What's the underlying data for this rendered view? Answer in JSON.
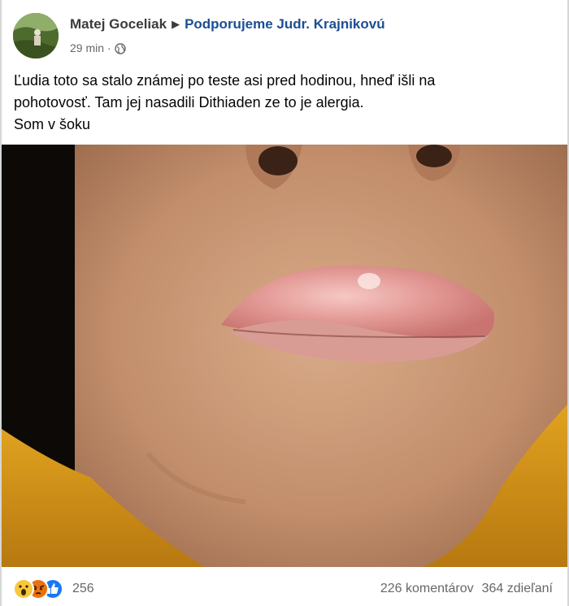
{
  "post": {
    "author": "Matej Goceliak",
    "group": "Podporujeme Judr. Krajnikovú",
    "time": "29 min",
    "separator": "·",
    "privacy_icon": "globe-icon",
    "text_lines": [
      "Ľudia toto sa stalo známej po teste asi pred hodinou, hneď išli na",
      "pohotovosť. Tam jej nasadili Dithiaden ze to je alergia.",
      "Som v šoku"
    ]
  },
  "footer": {
    "reaction_icons": [
      "wow-reaction-icon",
      "angry-reaction-icon",
      "like-reaction-icon"
    ],
    "reaction_count": "256",
    "comments": "226 komentárov",
    "shares": "364 zdieľaní"
  },
  "colors": {
    "author": "#3a3b3c",
    "group_link": "#1b4e94",
    "secondary": "#65676b",
    "like_blue": "#1877f2"
  }
}
